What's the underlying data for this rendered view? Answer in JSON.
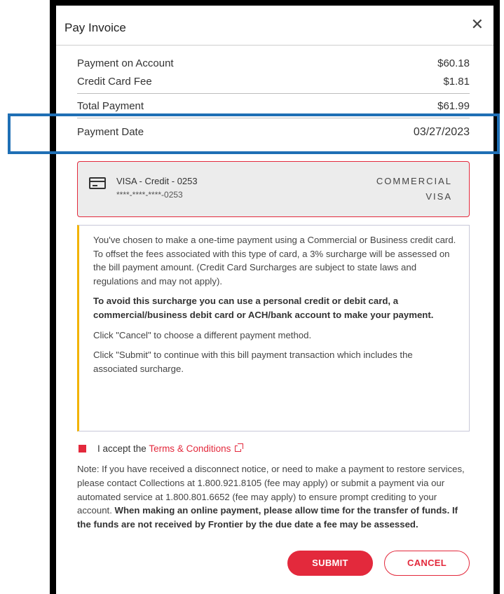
{
  "dialog": {
    "title": "Pay Invoice",
    "close_icon": "close-icon"
  },
  "summary": {
    "payment_on_account_label": "Payment on Account",
    "payment_on_account_value": "$60.18",
    "fee_label": "Credit Card Fee",
    "fee_value": "$1.81",
    "total_label": "Total Payment",
    "total_value": "$61.99",
    "date_label": "Payment Date",
    "date_value": "03/27/2023"
  },
  "card": {
    "icon": "credit-card-icon",
    "name": "VISA - Credit - 0253",
    "masked_number": "****-****-****-0253",
    "type_line1": "COMMERCIAL",
    "type_line2": "VISA"
  },
  "notice": {
    "p1": "You've chosen to make a one-time payment using a Commercial or Business credit card. To offset the fees associated with this type of card, a 3% surcharge will be assessed on the bill payment amount. (Credit Card Surcharges are subject to state laws and regulations and may not apply).",
    "p2": "To avoid this surcharge you can use a personal credit or debit card, a commercial/business debit card or ACH/bank account to make your payment.",
    "p3": "Click \"Cancel\" to choose a different payment method.",
    "p4": "Click \"Submit\" to continue with this bill payment transaction which includes the associated surcharge."
  },
  "terms": {
    "prefix": "I accept the",
    "link": "Terms & Conditions"
  },
  "note": {
    "regular": "Note: If you have received a disconnect notice, or need to make a payment to restore services, please contact Collections at 1.800.921.8105 (fee may apply) or submit a payment via our automated service at 1.800.801.6652 (fee may apply) to ensure prompt crediting to your account.",
    "bold": "When making an online payment, please allow time for the transfer of funds. If the funds are not received by Frontier by the due date a fee may be assessed."
  },
  "buttons": {
    "submit": "SUBMIT",
    "cancel": "CANCEL"
  },
  "colors": {
    "accent": "#e3293c",
    "notice_bar": "#f2b300",
    "highlight": "#1f6fb5"
  }
}
